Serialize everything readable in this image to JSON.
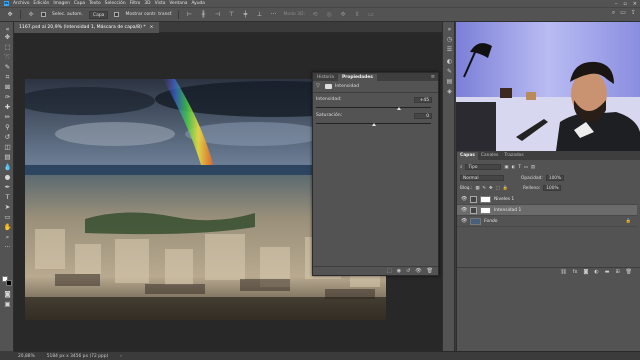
{
  "menu": {
    "items": [
      "Archivo",
      "Edición",
      "Imagen",
      "Capa",
      "Texto",
      "Selección",
      "Filtro",
      "3D",
      "Vista",
      "Ventana",
      "Ayuda"
    ]
  },
  "options_bar": {
    "smoothing_label": "Selec. autom.",
    "target_value": "Capa",
    "transform_label": "Mostrar contr. transf.",
    "mode_label": "Modo 3D:"
  },
  "document": {
    "tab_title": "1167.psd al 20,9% (Intensidad 1, Máscara de capa/8) *",
    "close_glyph": "×"
  },
  "properties": {
    "tab_history": "Historia",
    "tab_properties": "Propiedades",
    "adjustment_title": "Intensidad",
    "vibrance_label": "Intensidad:",
    "vibrance_value": "+45",
    "vibrance_fraction": 0.725,
    "saturation_label": "Saturación:",
    "saturation_value": "0",
    "saturation_fraction": 0.5
  },
  "layers": {
    "tab_layers": "Capas",
    "tab_channels": "Canales",
    "tab_paths": "Trazados",
    "filter_value": "Tipo",
    "blend_mode": "Normal",
    "opacity_label": "Opacidad:",
    "opacity_value": "100%",
    "lock_label": "Bloq.:",
    "fill_label": "Relleno:",
    "fill_value": "100%",
    "items": [
      {
        "name": "Niveles 1",
        "selected": false
      },
      {
        "name": "Intensidad 1",
        "selected": true
      },
      {
        "name": "Fondo",
        "selected": false
      }
    ]
  },
  "status": {
    "zoom": "20,88%",
    "dimensions": "5184 px x 3456 px (72 ppp)"
  }
}
